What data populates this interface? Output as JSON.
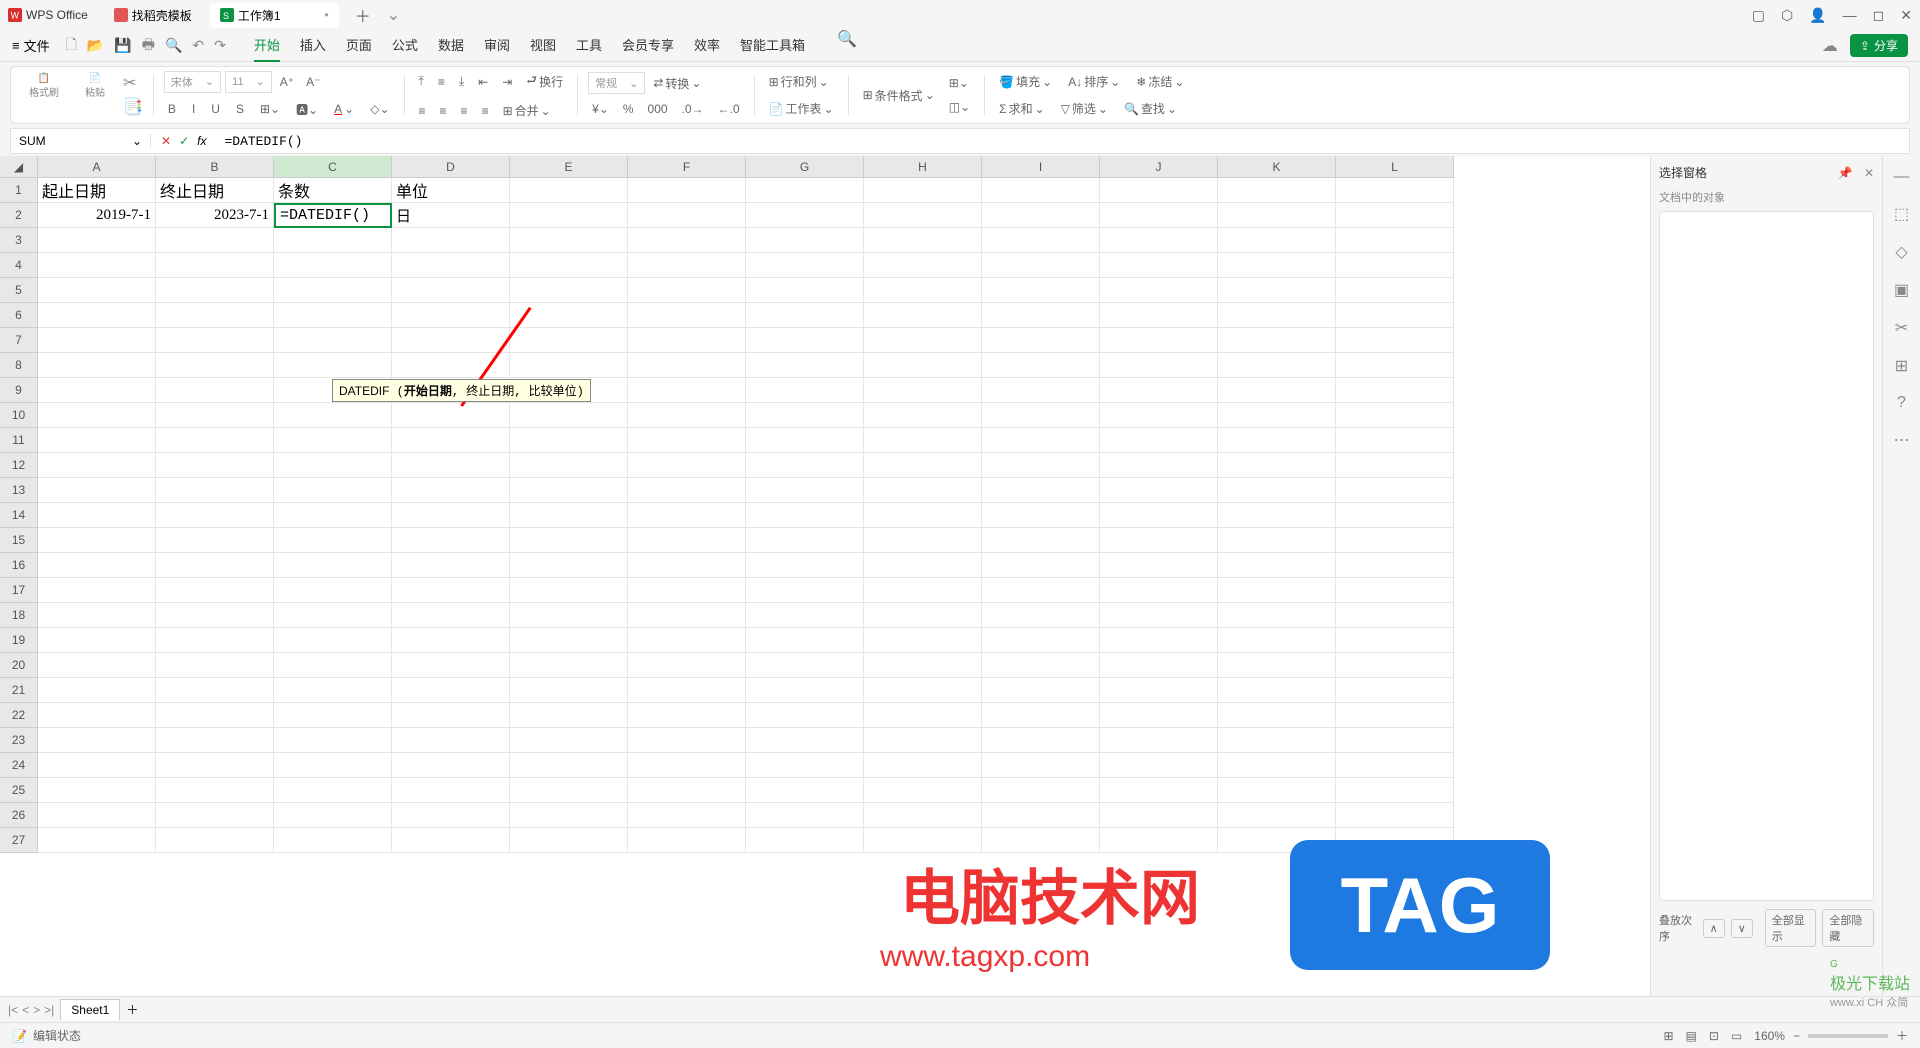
{
  "titlebar": {
    "app_name": "WPS Office",
    "tabs": [
      {
        "label": "找稻壳模板",
        "icon": "template"
      },
      {
        "label": "工作簿1",
        "icon": "sheet",
        "active": true
      }
    ]
  },
  "menubar": {
    "file_label": "文件",
    "tabs": [
      "开始",
      "插入",
      "页面",
      "公式",
      "数据",
      "审阅",
      "视图",
      "工具",
      "会员专享",
      "效率",
      "智能工具箱"
    ],
    "active_tab": "开始",
    "share_label": "分享"
  },
  "ribbon": {
    "paste_label": "粘贴",
    "format_painter": "格式刷",
    "font_name": "宋体",
    "font_size": "11",
    "wrap_label": "换行",
    "merge_label": "合并",
    "number_format": "常规",
    "convert_label": "转换",
    "row_col_label": "行和列",
    "worksheet_label": "工作表",
    "cond_format_label": "条件格式",
    "fill_label": "填充",
    "sort_label": "排序",
    "freeze_label": "冻结",
    "sum_label": "求和",
    "filter_label": "筛选",
    "find_label": "查找"
  },
  "formula_bar": {
    "name_box": "SUM",
    "formula": "=DATEDIF()"
  },
  "sheet": {
    "columns": [
      "A",
      "B",
      "C",
      "D",
      "E",
      "F",
      "G",
      "H",
      "I",
      "J",
      "K",
      "L"
    ],
    "rows": [
      "1",
      "2",
      "3",
      "4",
      "5",
      "6",
      "7",
      "8",
      "9",
      "10",
      "11",
      "12",
      "13",
      "14",
      "15",
      "16",
      "17",
      "18",
      "19",
      "20",
      "21",
      "22",
      "23",
      "24",
      "25",
      "26",
      "27"
    ],
    "cells": {
      "A1": "起止日期",
      "B1": "终止日期",
      "C1": "条数",
      "D1": "单位",
      "A2": "2019-7-1",
      "B2": "2023-7-1",
      "C2": "=DATEDIF()",
      "D2": "日"
    },
    "tooltip_fn": "DATEDIF",
    "tooltip_args": "(开始日期, 终止日期, 比较单位)",
    "tooltip_bold": "开始日期"
  },
  "side_panel": {
    "title": "选择窗格",
    "subtitle": "文档中的对象",
    "stack_label": "叠放次序",
    "show_all": "全部显示",
    "hide_all": "全部隐藏"
  },
  "sheet_tabs": {
    "active": "Sheet1"
  },
  "statusbar": {
    "mode": "编辑状态",
    "zoom": "160%"
  },
  "watermarks": {
    "main_cn": "电脑技术网",
    "main_url": "www.tagxp.com",
    "tag": "TAG",
    "corner": "极光下载站",
    "corner_url": "www.xi CH 众简"
  }
}
